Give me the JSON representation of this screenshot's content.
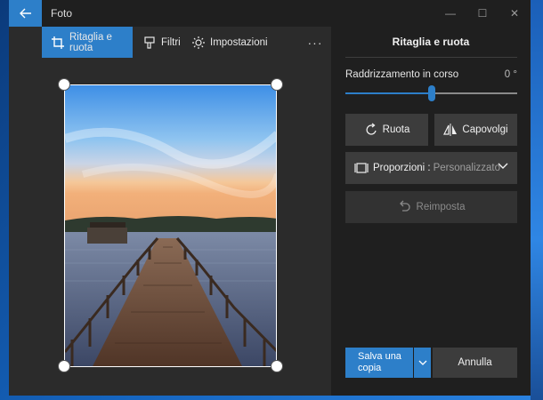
{
  "window": {
    "title": "Foto",
    "controls": {
      "minimize": "—",
      "maximize": "☐",
      "close": "✕"
    }
  },
  "toolbar": {
    "crop_label": "Ritaglia e ruota",
    "filters_label": "Filtri",
    "settings_label": "Impostazioni",
    "more_label": "···"
  },
  "panel": {
    "title": "Ritaglia e ruota",
    "straighten_label": "Raddrizzamento in corso",
    "straighten_value": "0 °",
    "straighten_level": 0.5,
    "rotate_label": "Ruota",
    "flip_label": "Capovolgi",
    "aspect_label": "Proporzioni :",
    "aspect_value": "Personalizzato",
    "reset_label": "Reimposta",
    "save_label_line1": "Salva una",
    "save_label_line2": "copia",
    "cancel_label": "Annulla"
  },
  "colors": {
    "accent": "#2d7fc9",
    "window_bg": "#1f1f1f",
    "canvas_bg": "#2b2b2b",
    "button_bg": "#3c3c3c"
  },
  "icons": {
    "back": "back-arrow-icon",
    "crop": "crop-icon",
    "filters": "filters-icon",
    "settings": "brightness-icon",
    "rotate": "rotate-icon",
    "flip": "flip-icon",
    "aspect": "aspect-ratio-icon",
    "reset": "undo-icon"
  }
}
